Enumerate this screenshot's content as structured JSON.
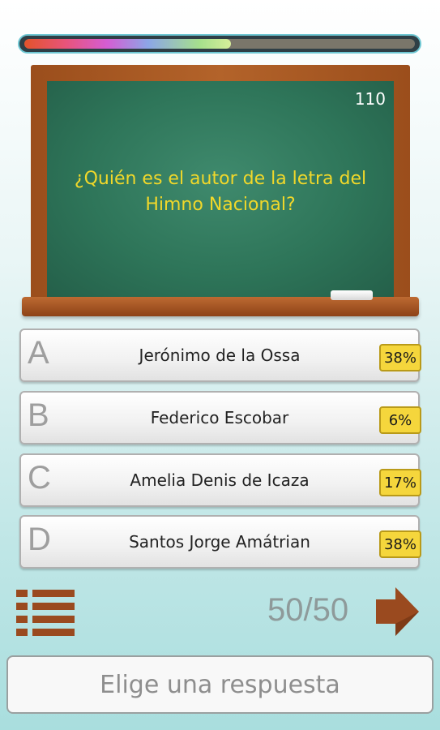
{
  "progress": {
    "fraction": 0.53
  },
  "board": {
    "counter": "110",
    "question": "¿Quién es el autor de la letra del Himno Nacional?"
  },
  "answers": [
    {
      "letter": "A",
      "text": "Jerónimo de la Ossa",
      "percent": "38%"
    },
    {
      "letter": "B",
      "text": "Federico Escobar",
      "percent": "6%"
    },
    {
      "letter": "C",
      "text": "Amelia Denis de Icaza",
      "percent": "17%"
    },
    {
      "letter": "D",
      "text": "Santos Jorge Amátrian",
      "percent": "38%"
    }
  ],
  "footer": {
    "question_counter": "50/50",
    "status": "Elige una respuesta",
    "menu_icon": "list-menu-icon",
    "next_icon": "next-arrow-icon"
  },
  "colors": {
    "question_text": "#f1d82a",
    "board_green": "#2e7559",
    "frame_brown": "#a55723",
    "percent_badge": "#f5d63c"
  }
}
